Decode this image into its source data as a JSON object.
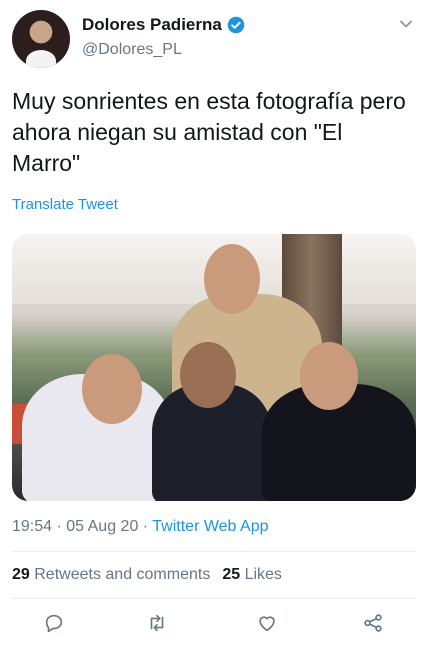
{
  "user": {
    "display_name": "Dolores Padierna",
    "handle": "@Dolores_PL",
    "verified": true,
    "avatar_icon": "user-avatar",
    "menu_icon": "chevron-down-icon"
  },
  "tweet": {
    "text": "Muy sonrientes en esta fotografía pero ahora niegan su amistad con \"El Marro\"",
    "translate_label": "Translate Tweet",
    "time": "19:54",
    "separator": " · ",
    "date": "05 Aug 20",
    "app": "Twitter Web App"
  },
  "stats": {
    "retweets_count": "29",
    "retweets_label": "Retweets and comments",
    "likes_count": "25",
    "likes_label": "Likes"
  },
  "actions": {
    "reply_icon": "reply-icon",
    "retweet_icon": "retweet-icon",
    "like_icon": "heart-icon",
    "share_icon": "share-icon"
  },
  "colors": {
    "accent": "#1b95e0",
    "secondary_text": "#657786",
    "primary_text": "#14171a",
    "divider": "#e6ecf0"
  }
}
